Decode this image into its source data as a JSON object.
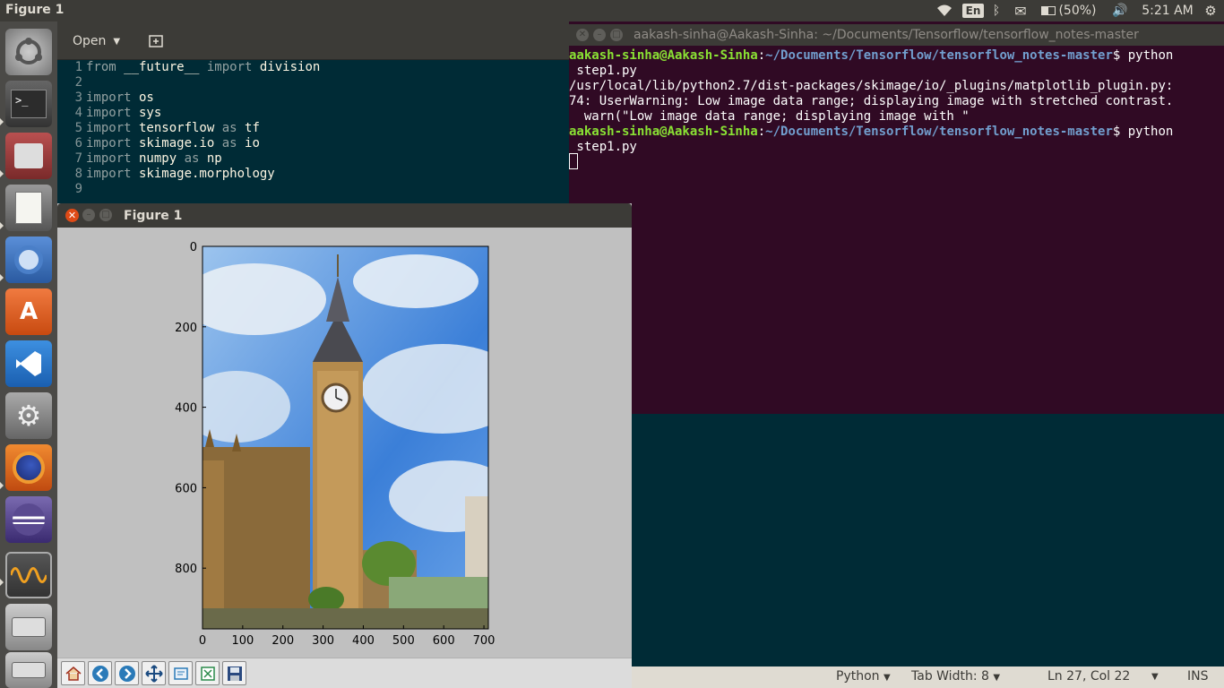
{
  "top_panel": {
    "title": "Figure 1",
    "lang": "En",
    "battery": "(50%)",
    "time": "5:21 AM"
  },
  "launcher": {
    "items": [
      {
        "name": "ubuntu-dash-icon"
      },
      {
        "name": "terminal-icon"
      },
      {
        "name": "file-manager-icon"
      },
      {
        "name": "text-editor-icon"
      },
      {
        "name": "chromium-icon"
      },
      {
        "name": "software-center-icon"
      },
      {
        "name": "vscode-icon"
      },
      {
        "name": "system-settings-icon"
      },
      {
        "name": "firefox-icon"
      },
      {
        "name": "eclipse-icon"
      },
      {
        "name": "oscilloscope-icon"
      },
      {
        "name": "drive-icon"
      },
      {
        "name": "drive-icon-2"
      }
    ]
  },
  "editor": {
    "open_label": "Open",
    "lines": [
      {
        "n": "1",
        "parts": [
          [
            "kw",
            "from"
          ],
          [
            "tx",
            " __future__ "
          ],
          [
            "kw",
            "import"
          ],
          [
            "tx",
            " division"
          ]
        ]
      },
      {
        "n": "2",
        "parts": []
      },
      {
        "n": "3",
        "parts": [
          [
            "kw",
            "import"
          ],
          [
            "tx",
            " os"
          ]
        ]
      },
      {
        "n": "4",
        "parts": [
          [
            "kw",
            "import"
          ],
          [
            "tx",
            " sys"
          ]
        ]
      },
      {
        "n": "5",
        "parts": [
          [
            "kw",
            "import"
          ],
          [
            "tx",
            " tensorflow "
          ],
          [
            "kw",
            "as"
          ],
          [
            "tx",
            " tf"
          ]
        ]
      },
      {
        "n": "6",
        "parts": [
          [
            "kw",
            "import"
          ],
          [
            "tx",
            " skimage.io "
          ],
          [
            "kw",
            "as"
          ],
          [
            "tx",
            " io"
          ]
        ]
      },
      {
        "n": "7",
        "parts": [
          [
            "kw",
            "import"
          ],
          [
            "tx",
            " numpy "
          ],
          [
            "kw",
            "as"
          ],
          [
            "tx",
            " np"
          ]
        ]
      },
      {
        "n": "8",
        "parts": [
          [
            "kw",
            "import"
          ],
          [
            "tx",
            " skimage.morphology"
          ]
        ]
      },
      {
        "n": "9",
        "parts": []
      }
    ]
  },
  "terminal": {
    "title": "aakash-sinha@Aakash-Sinha: ~/Documents/Tensorflow/tensorflow_notes-master",
    "user": "aakash-sinha@Aakash-Sinha",
    "path": "~/Documents/Tensorflow/tensorflow_notes-master",
    "cmd": "$ python",
    "cmd_cont": " step1.py",
    "warn1": "/usr/local/lib/python2.7/dist-packages/skimage/io/_plugins/matplotlib_plugin.py:",
    "warn2": "74: UserWarning: Low image data range; displaying image with stretched contrast.",
    "warn3": "  warn(\"Low image data range; displaying image with \""
  },
  "figure": {
    "title": "Figure 1",
    "image_alt": "Big Ben clock tower photo",
    "x_ticks": [
      "0",
      "100",
      "200",
      "300",
      "400",
      "500",
      "600",
      "700"
    ],
    "y_ticks": [
      "0",
      "200",
      "400",
      "600",
      "800"
    ],
    "toolbar": [
      "home-icon",
      "back-icon",
      "forward-icon",
      "pan-icon",
      "zoom-icon",
      "subplots-icon",
      "save-icon"
    ]
  },
  "statusbar": {
    "language": "Python",
    "tab_width": "Tab Width: 8",
    "position": "Ln 27, Col 22",
    "mode": "INS"
  }
}
